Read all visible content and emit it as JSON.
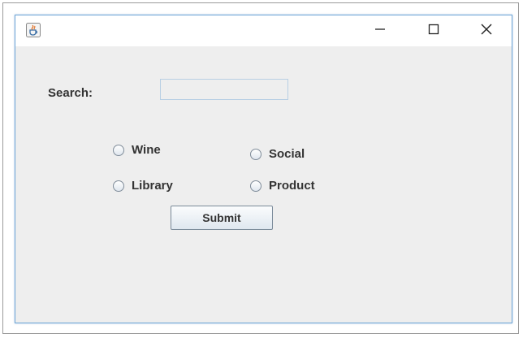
{
  "window": {
    "icon": "java-cup-icon",
    "controls": {
      "minimize_icon": "minimize-icon",
      "maximize_icon": "maximize-icon",
      "close_icon": "close-icon"
    },
    "accent_color": "#6fa6d6",
    "background_color": "#eeeeee"
  },
  "form": {
    "search_label": "Search:",
    "search_value": "",
    "options": [
      {
        "label": "Wine",
        "selected": false
      },
      {
        "label": "Social",
        "selected": false
      },
      {
        "label": "Library",
        "selected": false
      },
      {
        "label": "Product",
        "selected": false
      }
    ],
    "submit_label": "Submit"
  }
}
